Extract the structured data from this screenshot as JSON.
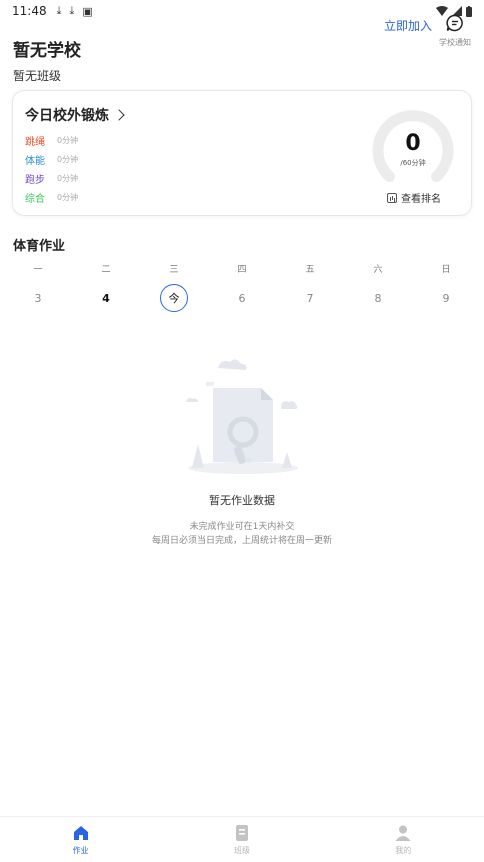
{
  "status_bar": {
    "time": "11:48"
  },
  "header": {
    "school_name": "暂无学校",
    "class_name": "暂无班级",
    "join_label": "立即加入",
    "notice_label": "学校通知"
  },
  "activity_card": {
    "title": "今日校外锻炼",
    "metrics": [
      {
        "name": "跳绳",
        "value": "0分钟",
        "color": "#e8502f"
      },
      {
        "name": "体能",
        "value": "0分钟",
        "color": "#2a8fd8"
      },
      {
        "name": "跑步",
        "value": "0分钟",
        "color": "#6e4ad6"
      },
      {
        "name": "综合",
        "value": "0分钟",
        "color": "#34c759"
      }
    ],
    "total_minutes": "0",
    "goal_label": "/60分钟",
    "progress_fraction": 0,
    "rank_label": "查看排名"
  },
  "homework": {
    "title": "体育作业",
    "days": [
      {
        "label": "一",
        "num": "3",
        "state": "normal"
      },
      {
        "label": "二",
        "num": "4",
        "state": "bold"
      },
      {
        "label": "三",
        "num": "今",
        "state": "today"
      },
      {
        "label": "四",
        "num": "6",
        "state": "normal"
      },
      {
        "label": "五",
        "num": "7",
        "state": "normal"
      },
      {
        "label": "六",
        "num": "8",
        "state": "normal"
      },
      {
        "label": "日",
        "num": "9",
        "state": "normal"
      }
    ],
    "empty_title": "暂无作业数据",
    "empty_desc_1": "未完成作业可在1天内补交",
    "empty_desc_2": "每周日必须当日完成，上周统计将在周一更新"
  },
  "bottom_nav": [
    {
      "label": "作业",
      "icon": "home-icon",
      "active": true
    },
    {
      "label": "班级",
      "icon": "class-icon",
      "active": false
    },
    {
      "label": "我的",
      "icon": "profile-icon",
      "active": false
    }
  ],
  "colors": {
    "accent": "#2b63e6",
    "gauge_track": "#ececec"
  }
}
